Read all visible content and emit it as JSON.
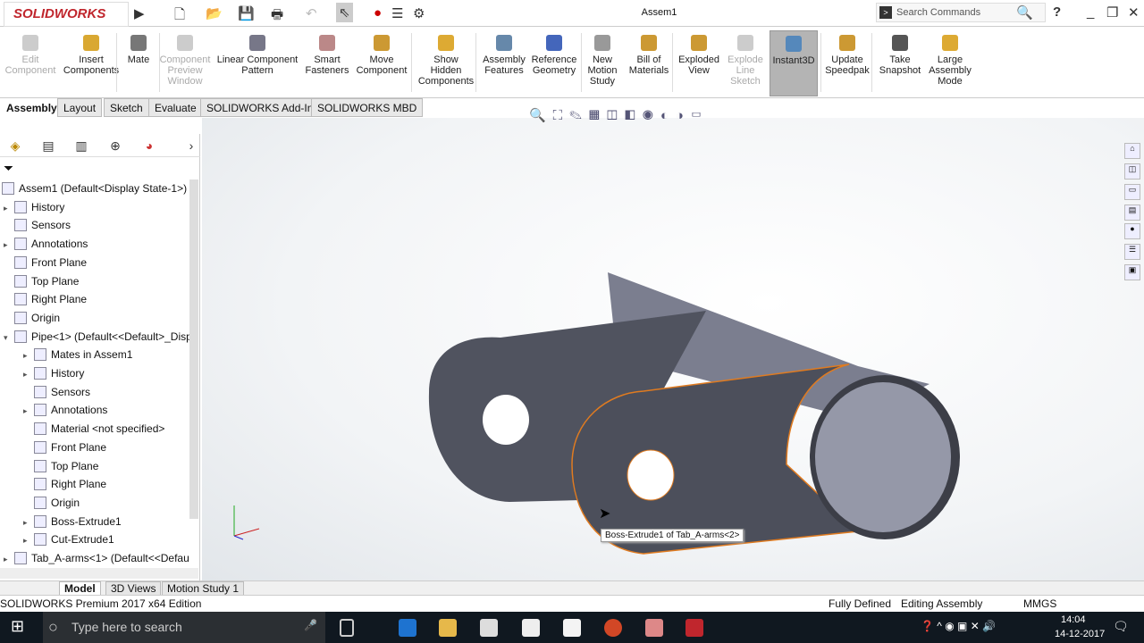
{
  "app": {
    "logo": "SOLIDWORKS",
    "title": "Assem1",
    "search_placeholder": "Search Commands",
    "help": "?"
  },
  "ribbon": [
    {
      "label": "Edit\nComponent",
      "state": "disabled"
    },
    {
      "label": "Insert\nComponents",
      "state": "normal"
    },
    {
      "label": "Mate",
      "state": "normal"
    },
    {
      "label": "Component\nPreview\nWindow",
      "state": "disabled"
    },
    {
      "label": "Linear Component\nPattern",
      "state": "normal"
    },
    {
      "label": "Smart\nFasteners",
      "state": "normal"
    },
    {
      "label": "Move\nComponent",
      "state": "normal"
    },
    {
      "label": "Show\nHidden\nComponents",
      "state": "normal"
    },
    {
      "label": "Assembly\nFeatures",
      "state": "normal"
    },
    {
      "label": "Reference\nGeometry",
      "state": "normal"
    },
    {
      "label": "New\nMotion\nStudy",
      "state": "normal"
    },
    {
      "label": "Bill of\nMaterials",
      "state": "normal"
    },
    {
      "label": "Exploded\nView",
      "state": "normal"
    },
    {
      "label": "Explode\nLine\nSketch",
      "state": "disabled"
    },
    {
      "label": "Instant3D",
      "state": "active"
    },
    {
      "label": "Update\nSpeedpak",
      "state": "normal"
    },
    {
      "label": "Take\nSnapshot",
      "state": "normal"
    },
    {
      "label": "Large\nAssembly\nMode",
      "state": "normal"
    }
  ],
  "tabs": [
    "Assembly",
    "Layout",
    "Sketch",
    "Evaluate",
    "SOLIDWORKS Add-Ins",
    "SOLIDWORKS MBD"
  ],
  "tree": [
    {
      "label": "Assem1  (Default<Display State-1>)",
      "level": 0,
      "exp": ""
    },
    {
      "label": "History",
      "level": 1,
      "exp": "▸"
    },
    {
      "label": "Sensors",
      "level": 1,
      "exp": ""
    },
    {
      "label": "Annotations",
      "level": 1,
      "exp": "▸"
    },
    {
      "label": "Front Plane",
      "level": 1,
      "exp": ""
    },
    {
      "label": "Top Plane",
      "level": 1,
      "exp": ""
    },
    {
      "label": "Right Plane",
      "level": 1,
      "exp": ""
    },
    {
      "label": "Origin",
      "level": 1,
      "exp": ""
    },
    {
      "label": "Pipe<1> (Default<<Default>_Disp",
      "level": 1,
      "exp": "▾"
    },
    {
      "label": "Mates in Assem1",
      "level": 2,
      "exp": "▸"
    },
    {
      "label": "History",
      "level": 2,
      "exp": "▸"
    },
    {
      "label": "Sensors",
      "level": 2,
      "exp": ""
    },
    {
      "label": "Annotations",
      "level": 2,
      "exp": "▸"
    },
    {
      "label": "Material <not specified>",
      "level": 2,
      "exp": ""
    },
    {
      "label": "Front Plane",
      "level": 2,
      "exp": ""
    },
    {
      "label": "Top Plane",
      "level": 2,
      "exp": ""
    },
    {
      "label": "Right Plane",
      "level": 2,
      "exp": ""
    },
    {
      "label": "Origin",
      "level": 2,
      "exp": ""
    },
    {
      "label": "Boss-Extrude1",
      "level": 2,
      "exp": "▸"
    },
    {
      "label": "Cut-Extrude1",
      "level": 2,
      "exp": "▸"
    },
    {
      "label": "Tab_A-arms<1> (Default<<Defau",
      "level": 1,
      "exp": "▸"
    }
  ],
  "tooltip": "Boss-Extrude1 of Tab_A-arms<2>",
  "bottom_tabs": [
    "Model",
    "3D Views",
    "Motion Study 1"
  ],
  "status": {
    "edition": "SOLIDWORKS Premium 2017 x64 Edition",
    "defined": "Fully Defined",
    "mode": "Editing Assembly",
    "units": "MMGS"
  },
  "taskbar": {
    "search_placeholder": "Type here to search",
    "time": "14:04",
    "date": "14-12-2017"
  },
  "colors": {
    "accent": "#c0262d",
    "part": "#5f6170",
    "highlight": "#e07b20",
    "taskbar": "#101820"
  }
}
